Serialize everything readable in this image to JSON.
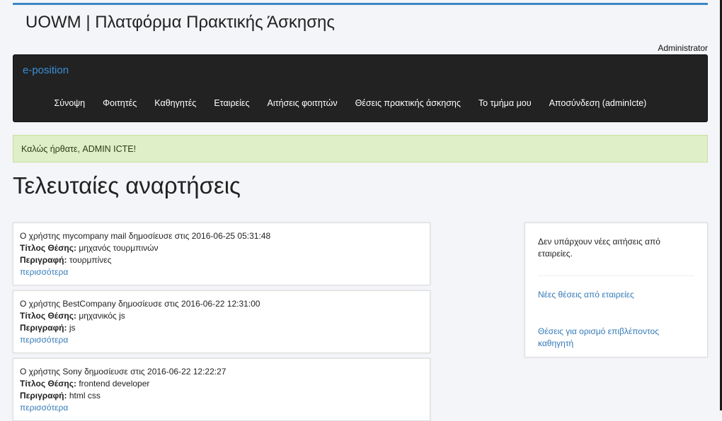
{
  "header": {
    "site_title": "UOWM | Πλατφόρμα Πρακτικής Άσκησης",
    "user": "Administrator"
  },
  "navbar": {
    "brand": "e-position",
    "items": [
      "Σύνοψη",
      "Φοιτητές",
      "Καθηγητές",
      "Εταιρείες",
      "Αιτήσεις φοιτητών",
      "Θέσεις πρακτικής άσκησης",
      "Το τμήμα μου",
      "Αποσύνδεση (adminIcte)"
    ]
  },
  "alert": {
    "message": "Καλώς ήρθατε, ADMIN ICTE!"
  },
  "main": {
    "heading": "Τελευταίες αναρτήσεις",
    "title_label": "Τίτλος Θέσης:",
    "desc_label": "Περιγραφή:",
    "more_label": "περισσότερα",
    "posts": [
      {
        "line": "Ο χρήστης mycompany mail δημοσίευσε στις 2016-06-25 05:31:48",
        "title": "μηχανός τουρμπινών",
        "description": "τουρμπίνες"
      },
      {
        "line": "Ο χρήστης BestCompany δημοσίευσε στις 2016-06-22 12:31:00",
        "title": "μηχανικός js",
        "description": "js"
      },
      {
        "line": "Ο χρήστης Sony δημοσίευσε στις 2016-06-22 12:22:27",
        "title": "frontend developer",
        "description": "html css"
      }
    ]
  },
  "sidebar": {
    "no_requests": "Δεν υπάρχουν νέες αιτήσεις από εταιρείες.",
    "link_new_positions": "Νέες θέσεις από εταιρείες",
    "link_assign_supervisor": "Θέσεις για ορισμό επιβλέποντος καθηγητή"
  },
  "colors": {
    "accent": "#337ab7",
    "navbar_bg": "#222222",
    "alert_bg": "#dff0c8"
  }
}
